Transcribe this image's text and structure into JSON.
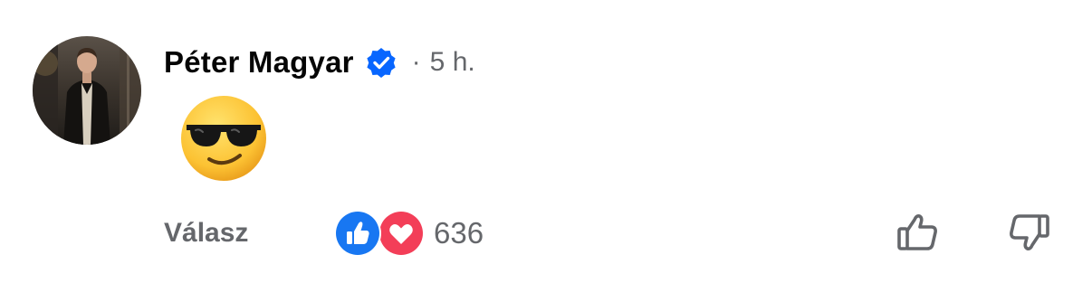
{
  "comment": {
    "author": "Péter Magyar",
    "separator": "·",
    "time": "5 h.",
    "verified": true,
    "avatar": "profile-photo",
    "body_emoji": "smiling-face-with-sunglasses",
    "reply_label": "Válasz",
    "reaction_count": "636",
    "reactions": [
      "like",
      "love"
    ],
    "vote_icons": [
      "thumbs-up-outline-icon",
      "thumbs-down-outline-icon"
    ]
  },
  "colors": {
    "text_primary": "#050505",
    "text_secondary": "#65676b",
    "verified_blue": "#0866ff",
    "like_blue": "#1877f2",
    "love_red": "#f33e58"
  }
}
